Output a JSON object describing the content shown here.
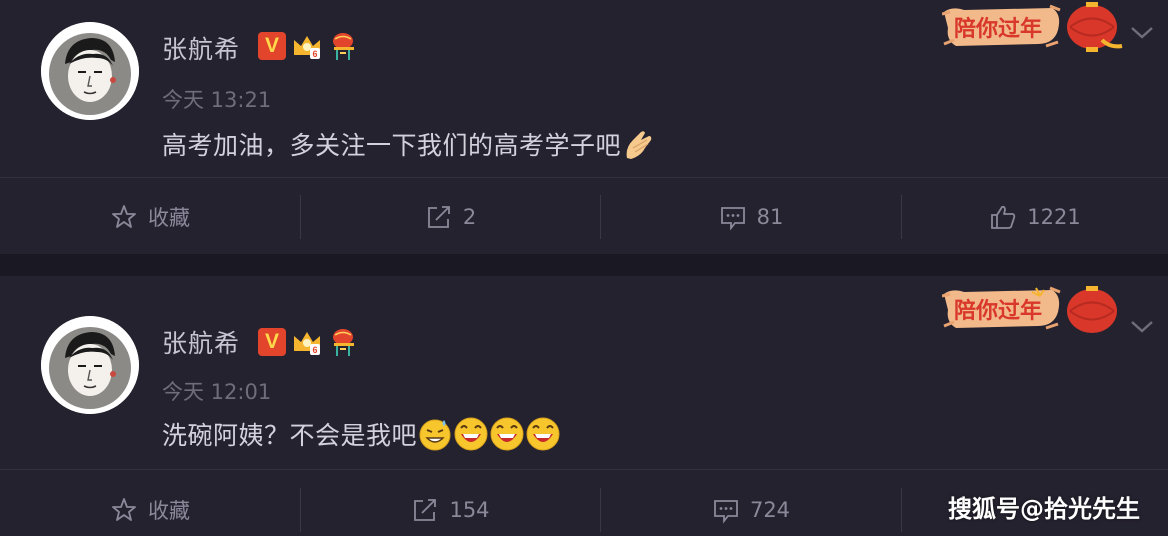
{
  "posts": [
    {
      "username": "张航希",
      "timestamp": "今天 13:21",
      "text": "高考加油，多关注一下我们的高考学子吧",
      "emojis": [
        "pray-hands-emoji"
      ],
      "festival_banner": "陪你过年",
      "actions": {
        "favorite_label": "收藏",
        "share_count": "2",
        "comment_count": "81",
        "like_count": "1221"
      }
    },
    {
      "username": "张航希",
      "timestamp": "今天 12:01",
      "text": "洗碗阿姨？不会是我吧",
      "emojis": [
        "sweat-grin-emoji",
        "laugh-emoji",
        "laugh-emoji",
        "laugh-emoji"
      ],
      "festival_banner": "陪你过年",
      "actions": {
        "favorite_label": "收藏",
        "share_count": "154",
        "comment_count": "724",
        "like_count": ""
      }
    }
  ],
  "watermark": "搜狐号@拾光先生",
  "colors": {
    "background": "#1c1a26",
    "card": "#25222f",
    "verified_badge": "#e2452c",
    "festival_red": "#d8372a"
  }
}
